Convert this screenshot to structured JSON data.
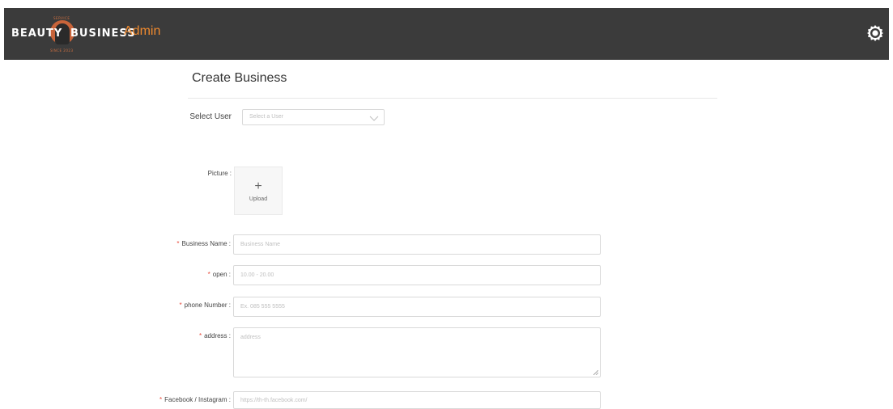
{
  "header": {
    "logo_left": "BEAUTY",
    "logo_right": "BUSINESS",
    "logo_top_small": "SERVICE",
    "logo_bottom_small": "SINCE 2023",
    "admin_label": "Admin",
    "background": "#3b3b3b",
    "accent": "#f08a2e"
  },
  "page": {
    "title": "Create Business"
  },
  "form": {
    "select_user": {
      "label": "Select User",
      "placeholder": "Select a User"
    },
    "picture": {
      "label": "Picture :",
      "upload_icon": "+",
      "upload_text": "Upload"
    },
    "business_name": {
      "required": "*",
      "label": "Business Name :",
      "placeholder": "Business Name"
    },
    "open": {
      "required": "*",
      "label": "open :",
      "placeholder": "10.00 - 20.00"
    },
    "phone": {
      "required": "*",
      "label": "phone Number :",
      "placeholder": "Ex. 085 555 5555"
    },
    "address": {
      "required": "*",
      "label": "address :",
      "placeholder": "address"
    },
    "social": {
      "required": "*",
      "label": "Facebook / Instagram :",
      "placeholder": "https://th-th.facebook.com/"
    }
  },
  "icons": {
    "settings": "gear-icon",
    "dropdown": "chevron-down-icon",
    "upload": "plus-icon"
  },
  "colors": {
    "required": "#e8493a",
    "border": "#d9d9d9"
  }
}
